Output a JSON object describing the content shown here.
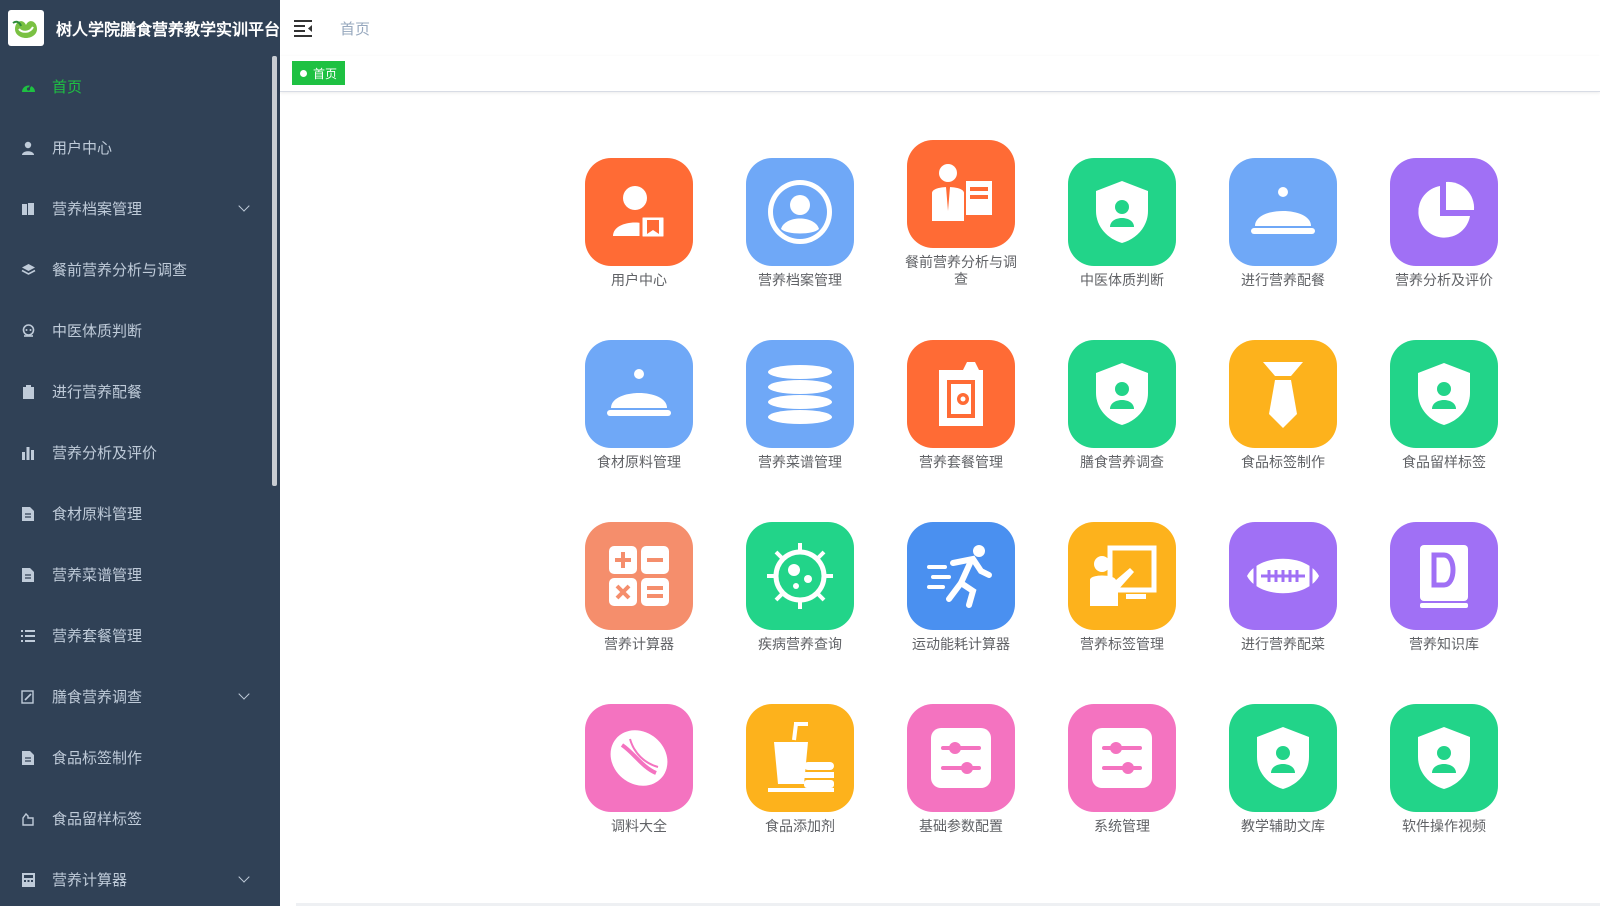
{
  "app": {
    "title": "树人学院膳食营养教学实训平台"
  },
  "header": {
    "breadcrumb": "首页"
  },
  "tags": [
    {
      "label": "首页"
    }
  ],
  "sidebar": {
    "items": [
      {
        "label": "首页",
        "icon": "dashboard-icon"
      },
      {
        "label": "用户中心",
        "icon": "user-icon"
      },
      {
        "label": "营养档案管理",
        "icon": "archive-icon"
      },
      {
        "label": "餐前营养分析与调查",
        "icon": "layers-icon"
      },
      {
        "label": "中医体质判断",
        "icon": "robot-icon"
      },
      {
        "label": "进行营养配餐",
        "icon": "clipboard-icon"
      },
      {
        "label": "营养分析及评价",
        "icon": "bar-chart-icon"
      },
      {
        "label": "食材原料管理",
        "icon": "document-icon"
      },
      {
        "label": "营养菜谱管理",
        "icon": "document-icon"
      },
      {
        "label": "营养套餐管理",
        "icon": "list-icon"
      },
      {
        "label": "膳食营养调查",
        "icon": "edit-icon"
      },
      {
        "label": "食品标签制作",
        "icon": "document-icon"
      },
      {
        "label": "食品留样标签",
        "icon": "hand-icon"
      },
      {
        "label": "营养计算器",
        "icon": "calculator-icon"
      }
    ]
  },
  "tiles": [
    {
      "label": "用户中心",
      "color": "#ff6b35",
      "icon": "user-card-icon"
    },
    {
      "label": "营养档案管理",
      "color": "#6fa8f7",
      "icon": "user-circle-icon"
    },
    {
      "label": "餐前营养分析与调查",
      "color": "#ff6b35",
      "icon": "person-board-icon"
    },
    {
      "label": "中医体质判断",
      "color": "#22d489",
      "icon": "shield-user-icon"
    },
    {
      "label": "进行营养配餐",
      "color": "#6fa8f7",
      "icon": "cloche-icon"
    },
    {
      "label": "营养分析及评价",
      "color": "#a070f5",
      "icon": "pie-chart-icon"
    },
    {
      "label": "食材原料管理",
      "color": "#6fa8f7",
      "icon": "cloche-icon"
    },
    {
      "label": "营养菜谱管理",
      "color": "#6fa8f7",
      "icon": "database-icon"
    },
    {
      "label": "营养套餐管理",
      "color": "#ff6b35",
      "icon": "tag-box-icon"
    },
    {
      "label": "膳食营养调查",
      "color": "#22d489",
      "icon": "shield-user-icon"
    },
    {
      "label": "食品标签制作",
      "color": "#fdb21c",
      "icon": "necktie-icon"
    },
    {
      "label": "食品留样标签",
      "color": "#22d489",
      "icon": "shield-user-icon"
    },
    {
      "label": "营养计算器",
      "color": "#f58e6c",
      "icon": "calculator-icon"
    },
    {
      "label": "疾病营养查询",
      "color": "#22d489",
      "icon": "virus-icon"
    },
    {
      "label": "运动能耗计算器",
      "color": "#4a90f0",
      "icon": "runner-icon"
    },
    {
      "label": "营养标签管理",
      "color": "#fdb21c",
      "icon": "teacher-icon"
    },
    {
      "label": "进行营养配菜",
      "color": "#a070f5",
      "icon": "football-icon"
    },
    {
      "label": "营养知识库",
      "color": "#a070f5",
      "icon": "book-icon"
    },
    {
      "label": "调料大全",
      "color": "#f473c0",
      "icon": "seed-icon"
    },
    {
      "label": "食品添加剂",
      "color": "#fdb21c",
      "icon": "fastfood-icon"
    },
    {
      "label": "基础参数配置",
      "color": "#f473c0",
      "icon": "sliders-icon"
    },
    {
      "label": "系统管理",
      "color": "#f473c0",
      "icon": "sliders-icon"
    },
    {
      "label": "教学辅助文库",
      "color": "#22d489",
      "icon": "shield-user-icon"
    },
    {
      "label": "软件操作视频",
      "color": "#22d489",
      "icon": "shield-user-icon"
    }
  ],
  "colors": {
    "sidebar_bg": "#304156",
    "accent": "#1ec142",
    "menu_text": "#bfcbd9"
  }
}
